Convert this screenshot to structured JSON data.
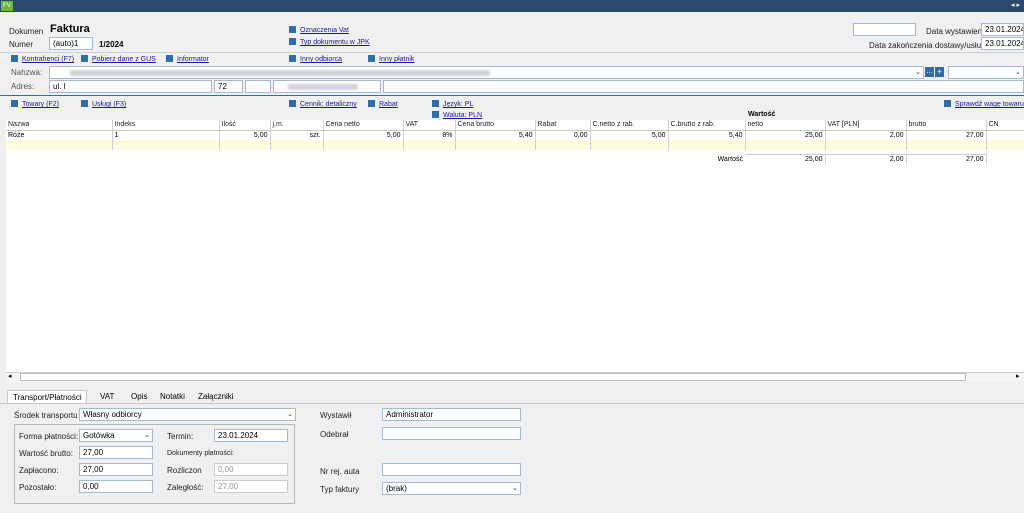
{
  "app": {
    "icon_label": "FV",
    "window_controls": "◂ ▸"
  },
  "doc": {
    "label": "Dokumen",
    "type": "Faktura",
    "number_label": "Numer",
    "number_prefix": "(auto)1",
    "number_suffix": "1/2024",
    "links_mid": [
      "Oznaczenia Vat",
      "Typ dokumentu w JPK"
    ],
    "issue_date_label": "Data wystawieni",
    "issue_date": "23.01.2024",
    "delivery_date_label": "Data zakończenia dostawy/usług",
    "delivery_date": "23.01.2024"
  },
  "contractor": {
    "links": [
      "Kontrahenci (F7)",
      "Pobierz dane z GUS",
      "Informator",
      "Inny odbiorca",
      "Inny płatnik"
    ],
    "name_label": "Nahzwa:",
    "address_label": "Adres:",
    "address_value": "ul. l",
    "house_no": "72"
  },
  "toolbar": {
    "goods": "Towary (F2)",
    "services": "Usługi (F3)",
    "price_list": "Cennik: detaliczny",
    "discount": "Rabat",
    "language": "Język: PL",
    "currency": "Waluta: PLN",
    "check_weight": "Sprawdź wagę towaru"
  },
  "table": {
    "group_header": "Wartość",
    "columns": [
      "Nazwa",
      "Indeks",
      "Ilość",
      "j.m.",
      "Cena netto",
      "VAT",
      "Cena brutto",
      "Rabat",
      "C.netto z rab.",
      "C.brutto z rab.",
      "netto",
      "VAT [PLN]",
      "brutto",
      "CN"
    ],
    "rows": [
      [
        "Róże",
        "1",
        "5,00",
        "szt.",
        "5,00",
        "8%",
        "5,40",
        "0,00",
        "5,00",
        "5,40",
        "25,00",
        "2,00",
        "27,00",
        ""
      ]
    ],
    "summary_label": "Wartość",
    "summary": [
      "25,00",
      "2,00",
      "27,00"
    ]
  },
  "tabs": [
    "Transport/Płatności",
    "VAT",
    "Opis",
    "Notatki",
    "Załączniki"
  ],
  "transport": {
    "label": "Środek transportu",
    "value": "Własny odbiorcy",
    "pay_form_label": "Forma płatności:",
    "pay_form": "Gotówka",
    "term_label": "Termin:",
    "term": "23.01.2024",
    "gross_label": "Wartość brutto:",
    "gross": "27,00",
    "docs_label": "Dokumenty płatności:",
    "paid_label": "Zapłacono:",
    "paid": "27,00",
    "settled_label": "Rozliczon",
    "settled": "0,00",
    "rest_label": "Pozostało:",
    "rest": "0,00",
    "arrears_label": "Zaległość:",
    "arrears": "27,00"
  },
  "issuer": {
    "issued_label": "Wystawił",
    "issued": "Administrator",
    "received_label": "Odebrał",
    "received": "",
    "plate_label": "Nr rej. auta",
    "plate": "",
    "invoice_type_label": "Typ faktury",
    "invoice_type": "(brak)"
  }
}
